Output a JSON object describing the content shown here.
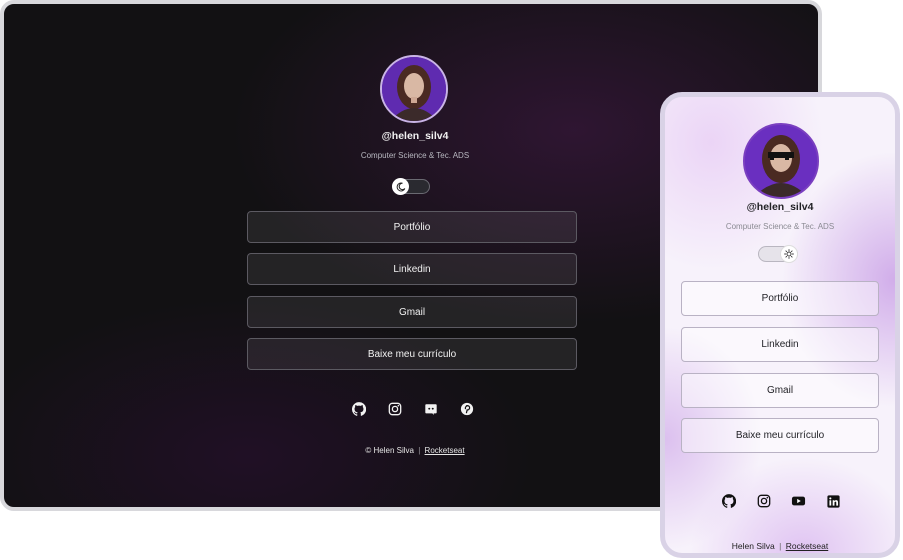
{
  "desktop": {
    "handle": "@helen_silv4",
    "subtitle": "Computer Science & Tec. ADS",
    "theme_toggle_icon": "moon-icon",
    "links": [
      "Portfólio",
      "Linkedin",
      "Gmail",
      "Baixe meu currículo"
    ],
    "social_icons": [
      "github-icon",
      "instagram-icon",
      "discord-icon",
      "pinterest-icon"
    ],
    "footer": {
      "prefix": "© Helen Silva",
      "separator": "|",
      "link": "Rocketseat"
    }
  },
  "mobile": {
    "handle": "@helen_silv4",
    "subtitle": "Computer Science & Tec. ADS",
    "theme_toggle_icon": "sun-icon",
    "links": [
      "Portfólio",
      "Linkedin",
      "Gmail",
      "Baixe meu currículo"
    ],
    "social_icons": [
      "github-icon",
      "instagram-icon",
      "youtube-icon",
      "linkedin-icon"
    ],
    "footer": {
      "prefix": "Helen Silva",
      "separator": "|",
      "link": "Rocketseat"
    }
  },
  "colors": {
    "desktop_bg": "#121113",
    "accent_purple": "#6a2fc0",
    "mobile_bg": "#f7f2fb"
  }
}
